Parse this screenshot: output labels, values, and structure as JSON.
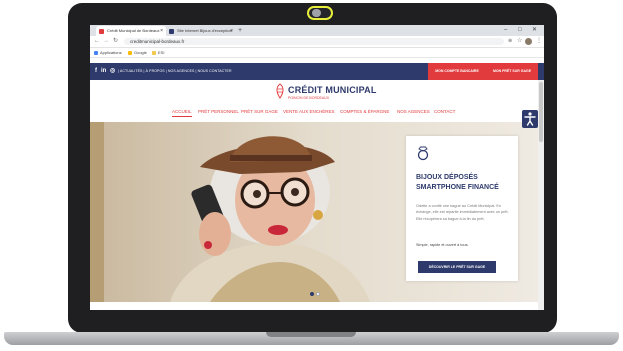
{
  "browser": {
    "tabs": [
      {
        "label": "Crédit Municipal de Bordeaux",
        "favicon_color": "#e23b3e",
        "active": true
      },
      {
        "label": "Site Internet Bijoux d'exception",
        "favicon_color": "#2d3a6b",
        "active": false
      }
    ],
    "new_tab": "+",
    "window_controls": {
      "minimize": "–",
      "maximize": "□",
      "close": "✕"
    },
    "nav": {
      "back": "←",
      "forward": "→",
      "reload": "↻"
    },
    "url": "creditmunicipal-bordeaux.fr",
    "bookmarks": [
      {
        "label": "Applications",
        "color": "#4285f4"
      },
      {
        "label": "Google",
        "color": "#fbbc05"
      },
      {
        "label": "ESI",
        "color": "#f2c94c"
      }
    ],
    "ext_icons": {
      "lens": "⊕",
      "star": "☆",
      "menu": "⋮"
    }
  },
  "site": {
    "social": {
      "facebook": "f",
      "linkedin": "in",
      "instagram": "◎"
    },
    "top_links": "| ACTUALITÉS | À PROPOS | NOS AGENCES | NOUS CONTACTER",
    "account_button": "MON COMPTE BANCAIRE",
    "loan_button": "MON PRÊT SUR GAGE",
    "logo_title": "CRÉDIT MUNICIPAL",
    "logo_sub": "POINCIN DE BORDEAUX",
    "menu": [
      "ACCUEIL",
      "PRÊT PERSONNEL",
      "PRÊT SUR GAGE",
      "VENTE AUX ENCHÈRES",
      "COMPTES & ÉPARGNE",
      "NOS AGENCES",
      "CONTACT"
    ],
    "accessibility_icon": "accessibility",
    "card": {
      "icon": "ring",
      "title_line1": "BIJOUX DÉPOSÉS",
      "title_line2": "SMARTPHONE FINANCÉ",
      "body": "Odette a confié une bague au Crédit Municipal. En échange, elle est repartie immédiatement avec un prêt. Elle récupérera sa bague à la fin du prêt.",
      "strong": "Simple, rapide et ouvert à tous.",
      "button": "DÉCOUVRIR LE PRÊT SUR GAGE"
    },
    "carousel": {
      "total": 2,
      "active": 1
    },
    "colors": {
      "navy": "#2d3a6b",
      "red": "#e23b3e"
    }
  }
}
